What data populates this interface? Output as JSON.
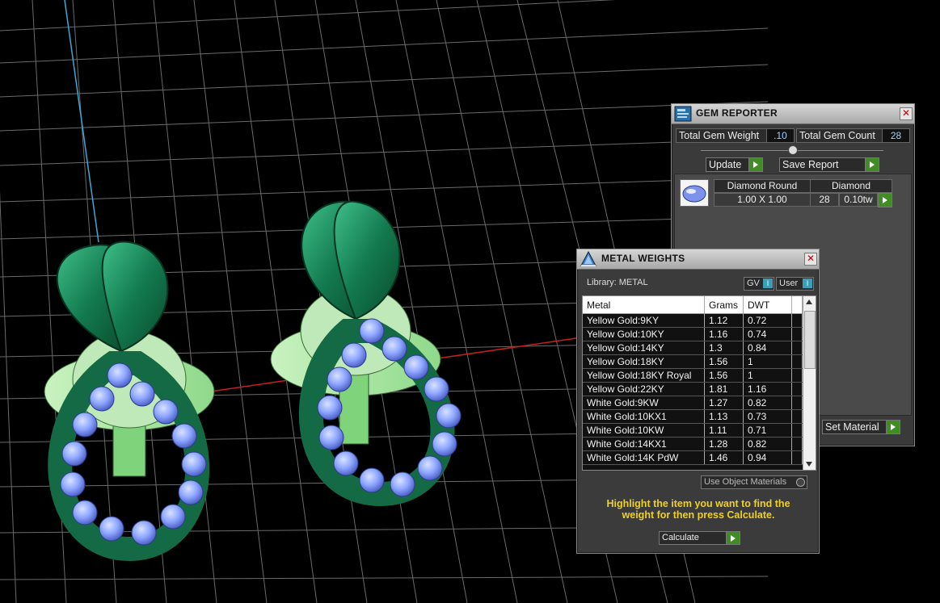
{
  "colors": {
    "accent_green": "#3f8d23",
    "gem_blue": "#8ea6ff",
    "metal_green": "#1c7a52",
    "highlight_text": "#f0d020"
  },
  "gem_reporter": {
    "title": "GEM REPORTER",
    "total_weight_label": "Total Gem Weight",
    "total_weight_value": ".10",
    "total_count_label": "Total Gem Count",
    "total_count_value": "28",
    "update_label": "Update",
    "save_report_label": "Save Report",
    "gem_row": {
      "name": "Diamond Round",
      "material": "Diamond",
      "size": "1.00 X 1.00",
      "count": "28",
      "weight": "0.10tw"
    },
    "set_material_label": "Set Material"
  },
  "metal_weights": {
    "title": "METAL WEIGHTS",
    "library_label": "Library: METAL",
    "gv_label": "GV",
    "user_label": "User",
    "columns": [
      "Metal",
      "Grams",
      "DWT"
    ],
    "rows": [
      [
        "Yellow Gold:9KY",
        "1.12",
        "0.72"
      ],
      [
        "Yellow Gold:10KY",
        "1.16",
        "0.74"
      ],
      [
        "Yellow Gold:14KY",
        "1.3",
        "0.84"
      ],
      [
        "Yellow Gold:18KY",
        "1.56",
        "1"
      ],
      [
        "Yellow Gold:18KY Royal",
        "1.56",
        "1"
      ],
      [
        "Yellow Gold:22KY",
        "1.81",
        "1.16"
      ],
      [
        "White Gold:9KW",
        "1.27",
        "0.82"
      ],
      [
        "White Gold:10KX1",
        "1.13",
        "0.73"
      ],
      [
        "White Gold:10KW",
        "1.11",
        "0.71"
      ],
      [
        "White Gold:14KX1",
        "1.28",
        "0.82"
      ],
      [
        "White Gold:14K PdW",
        "1.46",
        "0.94"
      ]
    ],
    "use_object_materials_label": "Use Object Materials",
    "hint": "Highlight the item you want to find the weight for then press Calculate.",
    "calculate_label": "Calculate"
  }
}
